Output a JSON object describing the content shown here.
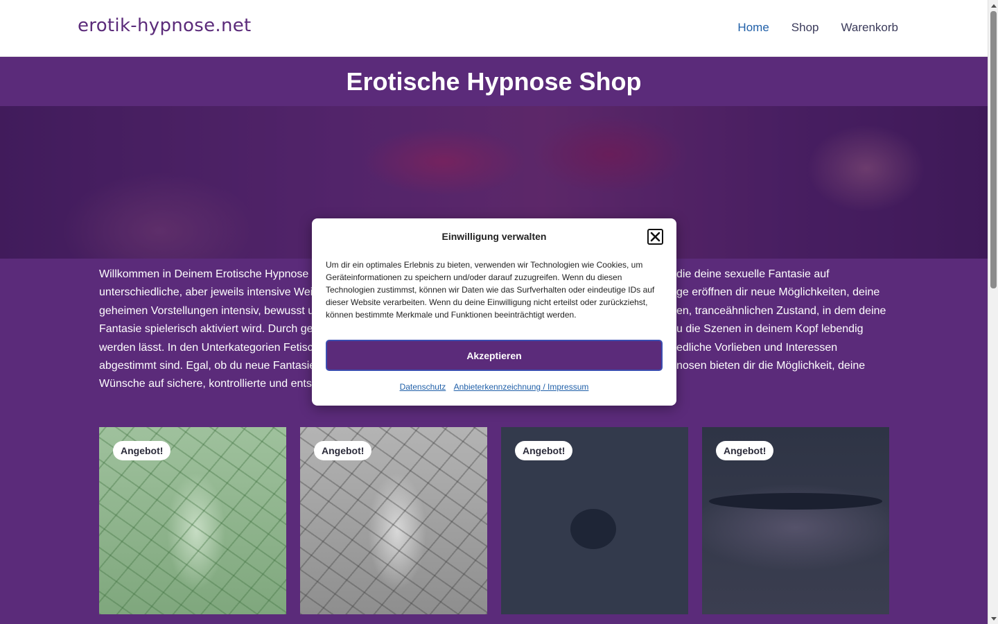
{
  "header": {
    "logo": "erotik-hypnose.net",
    "nav": [
      {
        "label": "Home"
      },
      {
        "label": "Shop"
      },
      {
        "label": "Warenkorb"
      }
    ]
  },
  "page": {
    "title": "Erotische Hypnose Shop",
    "intro_lines": [
      "Willkommen in Deinem Erotische Hypnose S",
      "unterschiedliche, aber jeweils intensive Wei",
      "geheimen Vorstellungen intensiv, bewusst u",
      "Fantasie spielerisch aktiviert wird. Durch ge",
      "werden lässt. In den Unterkategorien Fetisc",
      "abgestimmt sind. Egal, ob du neue Fantasie",
      "Wünsche auf sichere, kontrollierte und ents"
    ],
    "intro_lines_right": [
      "die deine sexuelle Fantasie auf",
      "ge eröffnen dir neue Möglichkeiten, deine",
      "en, tranceähnlichen Zustand, in dem deine",
      "u die Szenen in deinem Kopf lebendig",
      "edliche Vorlieben und Interessen",
      "nosen bieten dir die Möglichkeit, deine",
      ""
    ]
  },
  "products": [
    {
      "badge": "Angebot!"
    },
    {
      "badge": "Angebot!"
    },
    {
      "badge": "Angebot!"
    },
    {
      "badge": "Angebot!"
    }
  ],
  "consent": {
    "title": "Einwilligung verwalten",
    "text": "Um dir ein optimales Erlebnis zu bieten, verwenden wir Technologien wie Cookies, um Geräteinformationen zu speichern und/oder darauf zuzugreifen. Wenn du diesen Technologien zustimmst, können wir Daten wie das Surfverhalten oder eindeutige IDs auf dieser Website verarbeiten. Wenn du deine Einwilligung nicht erteilst oder zurückziehst, können bestimmte Merkmale und Funktionen beeinträchtigt werden.",
    "accept_label": "Akzeptieren",
    "links": [
      "Datenschutz",
      "Anbieterkennzeichnung / Impressum"
    ]
  },
  "colors": {
    "brand": "#5b2b7a",
    "link": "#1f5fa8"
  }
}
